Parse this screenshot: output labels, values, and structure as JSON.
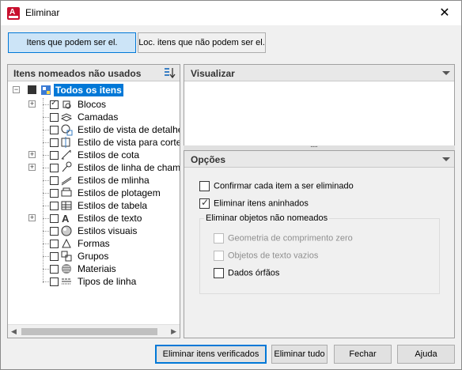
{
  "window": {
    "title": "Eliminar"
  },
  "tabs": [
    {
      "label": "Itens que podem ser el.",
      "active": true
    },
    {
      "label": "Loc. itens que não podem ser el.",
      "active": false
    }
  ],
  "left_panel": {
    "header": "Itens nomeados não usados",
    "root": {
      "label": "Todos os itens"
    },
    "items": [
      {
        "label": "Blocos",
        "icon": "blocks-icon",
        "expandable": true,
        "checked": true
      },
      {
        "label": "Camadas",
        "icon": "layers-icon",
        "expandable": false,
        "checked": false
      },
      {
        "label": "Estilo de vista de detalhe",
        "icon": "detail-view-style-icon",
        "expandable": false,
        "checked": false
      },
      {
        "label": "Estilo de vista para corte",
        "icon": "section-view-style-icon",
        "expandable": false,
        "checked": false
      },
      {
        "label": "Estilos de cota",
        "icon": "dimension-style-icon",
        "expandable": true,
        "checked": false
      },
      {
        "label": "Estilos de linha de chamada m",
        "icon": "multileader-style-icon",
        "expandable": true,
        "checked": false
      },
      {
        "label": "Estilos de mlinha",
        "icon": "mline-style-icon",
        "expandable": false,
        "checked": false
      },
      {
        "label": "Estilos de plotagem",
        "icon": "plot-style-icon",
        "expandable": false,
        "checked": false
      },
      {
        "label": "Estilos de tabela",
        "icon": "table-style-icon",
        "expandable": false,
        "checked": false
      },
      {
        "label": "Estilos de texto",
        "icon": "text-style-icon",
        "expandable": true,
        "checked": false
      },
      {
        "label": "Estilos visuais",
        "icon": "visual-style-icon",
        "expandable": false,
        "checked": false
      },
      {
        "label": "Formas",
        "icon": "shapes-icon",
        "expandable": false,
        "checked": false
      },
      {
        "label": "Grupos",
        "icon": "groups-icon",
        "expandable": false,
        "checked": false
      },
      {
        "label": "Materiais",
        "icon": "materials-icon",
        "expandable": false,
        "checked": false
      },
      {
        "label": "Tipos de linha",
        "icon": "linetypes-icon",
        "expandable": false,
        "checked": false
      }
    ]
  },
  "preview_panel": {
    "header": "Visualizar"
  },
  "options_panel": {
    "header": "Opções",
    "confirm_each": {
      "label": "Confirmar cada item a ser eliminado",
      "checked": false
    },
    "purge_nested": {
      "label": "Eliminar itens aninhados",
      "checked": true
    },
    "unnamed_group": {
      "title": "Eliminar objetos não nomeados",
      "zero_length": {
        "label": "Geometria de comprimento zero",
        "checked": false,
        "enabled": false
      },
      "empty_text": {
        "label": "Objetos de texto vazios",
        "checked": false,
        "enabled": false
      },
      "orphan_data": {
        "label": "Dados órfãos",
        "checked": false,
        "enabled": true
      }
    }
  },
  "buttons": {
    "purge_checked": "Eliminar itens verificados",
    "purge_all": "Eliminar tudo",
    "close": "Fechar",
    "help": "Ajuda"
  }
}
